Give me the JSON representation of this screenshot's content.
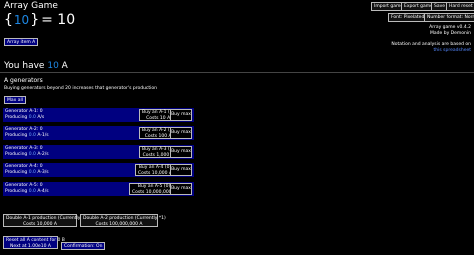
{
  "header": {
    "title": "Array Game",
    "equation": {
      "open": "{",
      "number": "10",
      "close": "}",
      "rest": "= 10"
    },
    "array_item_button": "Array item A"
  },
  "top_buttons": {
    "import": "Import game",
    "export": "Export game",
    "save": "Save",
    "hard_reset": "Hard reset",
    "font": "Font: Pixelated",
    "number_format": "Number format: Normal"
  },
  "info": {
    "version": "Array game v0.4.2",
    "made_by": "Made by Demonin",
    "notation_note": "Notation and analysis are based on",
    "notation_link": "this spreadsheet"
  },
  "resource": {
    "prefix": "You have",
    "amount": "10",
    "unit": "A"
  },
  "generators": {
    "title": "A generators",
    "subtitle": "Buying generators beyond 20 increases that generator's production",
    "max_all": "Max all",
    "rows": [
      {
        "name": "Generator A-1: 0",
        "producing_label": "Producing",
        "producing_value": "0.0",
        "producing_unit": "A/s",
        "buy": "Buy an A-1 (0)",
        "cost": "Costs 10 A",
        "max": "Buy max"
      },
      {
        "name": "Generator A-2: 0",
        "producing_label": "Producing",
        "producing_value": "0.0",
        "producing_unit": "A-1/s",
        "buy": "Buy an A-2 (0)",
        "cost": "Costs 100 A",
        "max": "Buy max"
      },
      {
        "name": "Generator A-3: 0",
        "producing_label": "Producing",
        "producing_value": "0.0",
        "producing_unit": "A-2/s",
        "buy": "Buy an A-3 (0)",
        "cost": "Costs 1,000 A",
        "max": "Buy max"
      },
      {
        "name": "Generator A-4: 0",
        "producing_label": "Producing",
        "producing_value": "0.0",
        "producing_unit": "A-3/s",
        "buy": "Buy an A-4 (0)",
        "cost": "Costs 10,000 A",
        "max": "Buy max"
      },
      {
        "name": "Generator A-5: 0",
        "producing_label": "Producing",
        "producing_value": "0.0",
        "producing_unit": "A-4/s",
        "buy": "Buy an A-5 (0)",
        "cost": "Costs 10,000,000 A",
        "max": "Buy max"
      }
    ]
  },
  "upgrades": [
    {
      "line1": "Double A-1 production (Currently *1)",
      "line2": "Costs 10,000 A"
    },
    {
      "line1": "Double A-2 production (Currently *1)",
      "line2": "Costs 100,000,000 A"
    }
  ],
  "reset": {
    "line1": "Reset all A content for 0 B",
    "line2": "Next at 1.00e10 A",
    "confirmation": "Confirmation: On"
  },
  "colors": {
    "accent": "#1e88e5",
    "row_bg": "#000080"
  }
}
